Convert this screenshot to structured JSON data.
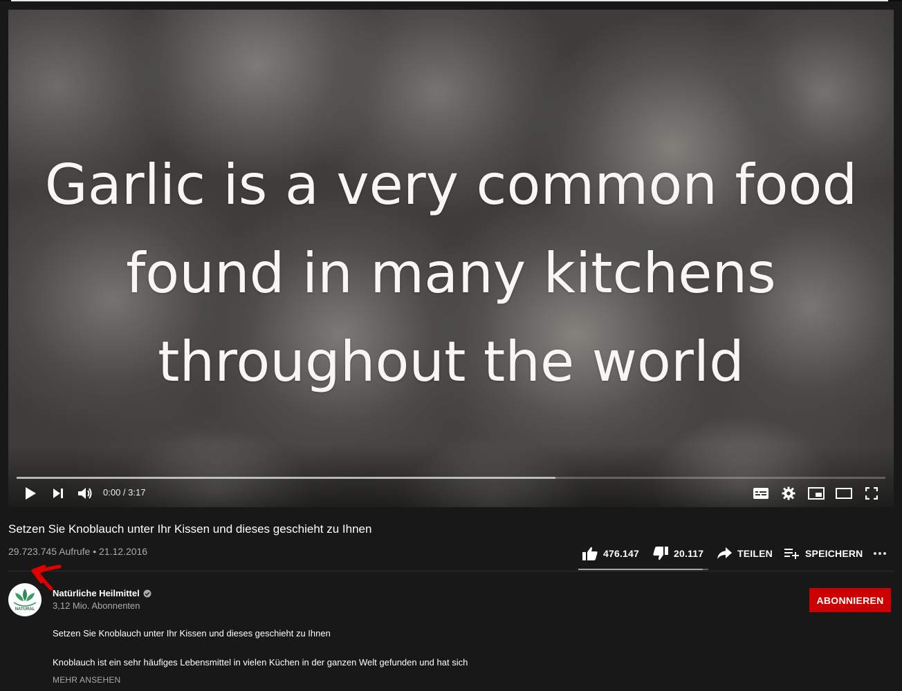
{
  "video": {
    "caption_lines": [
      "Garlic is a very common food",
      "found in many kitchens",
      "throughout the world"
    ],
    "current_time": "0:00",
    "duration": "3:17",
    "buffered_fraction": 0.62,
    "played_fraction": 0.0
  },
  "title": "Setzen Sie Knoblauch unter Ihr Kissen und dieses geschieht zu Ihnen",
  "meta": {
    "views": "29.723.745 Aufrufe",
    "separator": " • ",
    "date": "21.12.2016"
  },
  "actions": {
    "likes": "476.147",
    "dislikes": "20.117",
    "share_label": "TEILEN",
    "save_label": "SPEICHERN",
    "like_fraction": 0.96
  },
  "channel": {
    "name": "Natürliche Heilmittel",
    "subscribers": "3,12 Mio. Abonnenten",
    "subscribe_label": "ABONNIEREN",
    "avatar_text": "NATURAL"
  },
  "description": {
    "line1": "Setzen Sie Knoblauch unter Ihr Kissen und dieses geschieht zu Ihnen",
    "line2": "Knoblauch ist ein sehr häufiges Lebensmittel in vielen Küchen in der ganzen Welt gefunden und hat sich",
    "more_label": "MEHR ANSEHEN"
  },
  "colors": {
    "background": "#181818",
    "subscribe": "#cc0000",
    "annotation_arrow": "#e00000"
  }
}
